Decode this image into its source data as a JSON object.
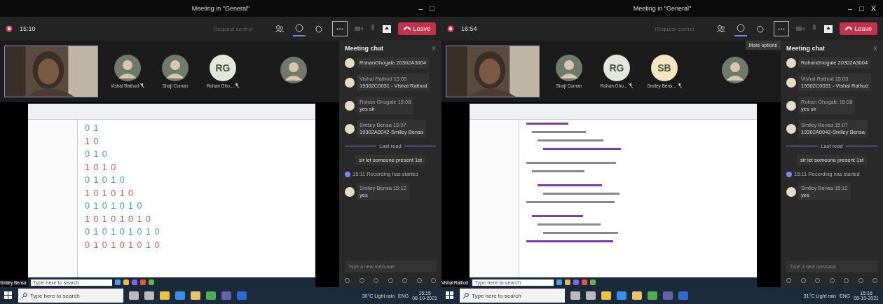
{
  "panels": [
    {
      "window": {
        "title": "Meeting in \"General\"",
        "controls": [
          "–",
          "□"
        ]
      },
      "toolbar": {
        "time": "15:10",
        "request": "Request control",
        "tools": [
          {
            "kind": "people",
            "selected": false
          },
          {
            "kind": "chat",
            "selected": true
          },
          {
            "kind": "reactions",
            "selected": false
          },
          {
            "kind": "more",
            "selected": false
          }
        ],
        "leave": "Leave"
      },
      "participants": [
        {
          "kind": "video"
        },
        {
          "name": "Vishal Rathod",
          "muted": true
        },
        {
          "name": "Shaji Cuman",
          "muted": false
        },
        {
          "kind": "initials",
          "initials": "RG",
          "name": "Rohan Gho...",
          "muted": true,
          "color": "#e3e6dc"
        },
        {
          "kind": "photo-far"
        }
      ],
      "screen": {
        "kind": "output",
        "lines": [
          "0 1",
          "1 0",
          "0 1 0",
          "1 0 1 0",
          "0 1 0 1 0",
          "1 0 1 0 1 0",
          "0 1 0 1 0 1 0",
          "1 0 1 0 1 0 1 0",
          "0 1 0 1 0 1 0 1 0",
          "0 1 0 1 0 1 0 1 0"
        ],
        "presenter": "Smiley Bensa",
        "search": "Type here to search"
      },
      "chat": {
        "title": "Meeting chat",
        "close": "X",
        "messages": [
          {
            "kind": "message",
            "text": "RohanGhogale 20302A3004"
          },
          {
            "kind": "message",
            "author": "Vishal Rathod",
            "time": "15:05",
            "text": "19302C0031 - Vishal Rathod"
          },
          {
            "kind": "message",
            "author": "Rohan Ghogale",
            "time": "15:08",
            "text": "yes sir"
          },
          {
            "kind": "message",
            "author": "Smiley Bensa",
            "time": "15:07",
            "text": "19302A0042-Smiley Bensa"
          },
          {
            "kind": "divider",
            "text": "Last read"
          },
          {
            "kind": "plain",
            "text": "sir let someone present 1st"
          },
          {
            "kind": "event",
            "time": "15:11",
            "text": "Recording has started"
          },
          {
            "kind": "message",
            "author": "Smiley Bensa",
            "time": "15:12",
            "text": "yes"
          }
        ],
        "placeholder": "Type a new message"
      },
      "taskbar": {
        "search": "Type here to search",
        "weather": "30°C Light rain",
        "lang": "ENG",
        "time": "15:15",
        "date": "08-10-2021"
      }
    },
    {
      "window": {
        "title": "Meeting in \"General\"",
        "controls": [
          "–",
          "□",
          "X"
        ]
      },
      "toolbar": {
        "time": "16:54",
        "request": "Request control",
        "tools": [
          {
            "kind": "people",
            "selected": false
          },
          {
            "kind": "chat",
            "selected": true
          },
          {
            "kind": "reactions",
            "selected": false
          },
          {
            "kind": "more",
            "selected": false
          }
        ],
        "leave": "Leave",
        "tooltip": "More options"
      },
      "participants": [
        {
          "kind": "video"
        },
        {
          "name": "Shaji Cuman",
          "muted": false
        },
        {
          "kind": "initials",
          "initials": "RG",
          "name": "Rohan Gho...",
          "muted": true,
          "color": "#e3e6dc"
        },
        {
          "kind": "initials",
          "initials": "SB",
          "name": "Smiley Bens...",
          "muted": true,
          "color": "#f3e6c0"
        },
        {
          "kind": "photo-far"
        }
      ],
      "screen": {
        "kind": "code",
        "presenter": "Vishal Rathod",
        "search": "Type here to search"
      },
      "chat": {
        "title": "Meeting chat",
        "close": "X",
        "messages": [
          {
            "kind": "message",
            "text": "RohanGhogale 20302A3004"
          },
          {
            "kind": "message",
            "author": "Vishal Rathod",
            "time": "15:05",
            "text": "19302C0031 - Vishal Rathod"
          },
          {
            "kind": "message",
            "author": "Rohan Ghogale",
            "time": "15:08",
            "text": "yes sir"
          },
          {
            "kind": "message",
            "author": "Smiley Bensa",
            "time": "15:07",
            "text": "19302A0042-Smiley Bensa"
          },
          {
            "kind": "divider",
            "text": "Last read"
          },
          {
            "kind": "plain",
            "text": "sir let someone present 1st"
          },
          {
            "kind": "event",
            "time": "15:11",
            "text": "Recording has started"
          },
          {
            "kind": "message",
            "author": "Smiley Bensa",
            "time": "15:12",
            "text": "yes"
          }
        ],
        "placeholder": "Type a new message"
      },
      "taskbar": {
        "search": "Type here to search",
        "weather": "31°C Light rain",
        "lang": "ENG",
        "time": "15:16",
        "date": "08-10-2021"
      }
    }
  ]
}
